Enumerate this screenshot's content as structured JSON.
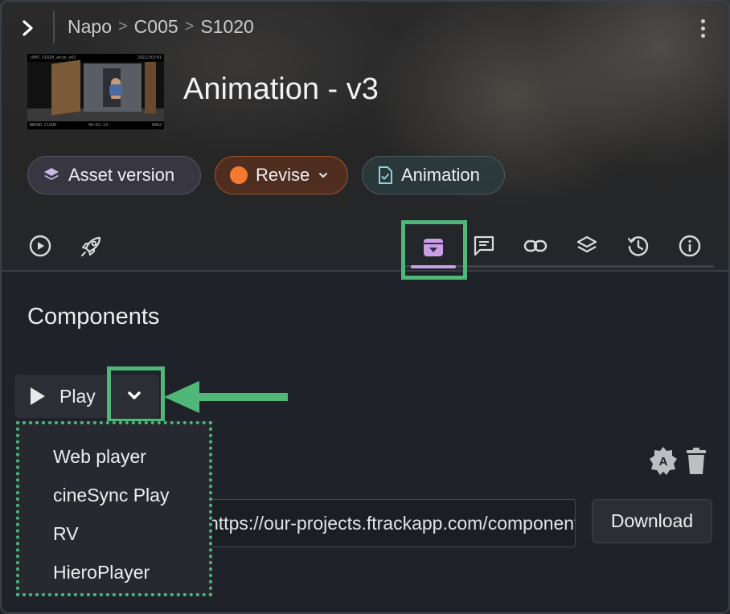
{
  "breadcrumb": [
    "Napo",
    "C005",
    "S1020"
  ],
  "breadcrumb_separator": ">",
  "thumbnail": {
    "top_left": "c005_S1020_anim_v03",
    "top_right": "2022/03/01",
    "bottom_left": "BREAD\nCLOUD",
    "bottom_center": "00:02:14",
    "bottom_right": "0062"
  },
  "title": "Animation - v3",
  "chips": {
    "asset_version": "Asset version",
    "status": "Revise",
    "type": "Animation"
  },
  "colors": {
    "status_revise": "#f47a33",
    "highlight": "#4fb879",
    "active_tab": "#c9a0e6"
  },
  "toolbar": {
    "left_icons": [
      "play-circle-icon",
      "rocket-icon"
    ],
    "tabs": [
      "components-icon",
      "notes-icon",
      "links-icon",
      "versions-icon",
      "history-icon",
      "info-icon"
    ],
    "active_tab": "components-icon"
  },
  "components": {
    "section_title": "Components",
    "play_label": "Play",
    "menu_items": [
      "Web player",
      "cineSync Play",
      "RV",
      "HieroPlayer"
    ],
    "url_value": "https://our-projects.ftrackapp.com/component",
    "download_label": "Download"
  }
}
